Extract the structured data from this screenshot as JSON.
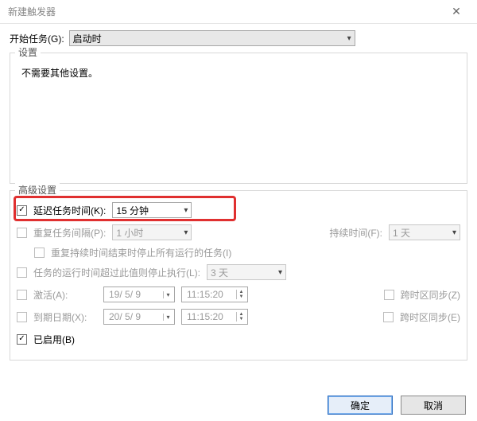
{
  "window": {
    "title": "新建触发器"
  },
  "begin": {
    "label": "开始任务(G):",
    "value": "启动时"
  },
  "settings": {
    "label": "设置",
    "text": "不需要其他设置。"
  },
  "advanced": {
    "label": "高级设置",
    "delay": {
      "label": "延迟任务时间(K):",
      "value": "15 分钟"
    },
    "repeat": {
      "label": "重复任务间隔(P):",
      "value": "1 小时",
      "duration_label": "持续时间(F):",
      "duration_value": "1 天"
    },
    "repeat_stop": {
      "label": "重复持续时间结束时停止所有运行的任务(I)"
    },
    "stop_after": {
      "label": "任务的运行时间超过此值则停止执行(L):",
      "value": "3 天"
    },
    "activate": {
      "label": "激活(A):",
      "date": "19/ 5/ 9",
      "time": "11:15:20",
      "tz_label": "跨时区同步(Z)"
    },
    "expire": {
      "label": "到期日期(X):",
      "date": "20/ 5/ 9",
      "time": "11:15:20",
      "tz_label": "跨时区同步(E)"
    },
    "enabled": {
      "label": "已启用(B)"
    }
  },
  "buttons": {
    "ok": "确定",
    "cancel": "取消"
  }
}
